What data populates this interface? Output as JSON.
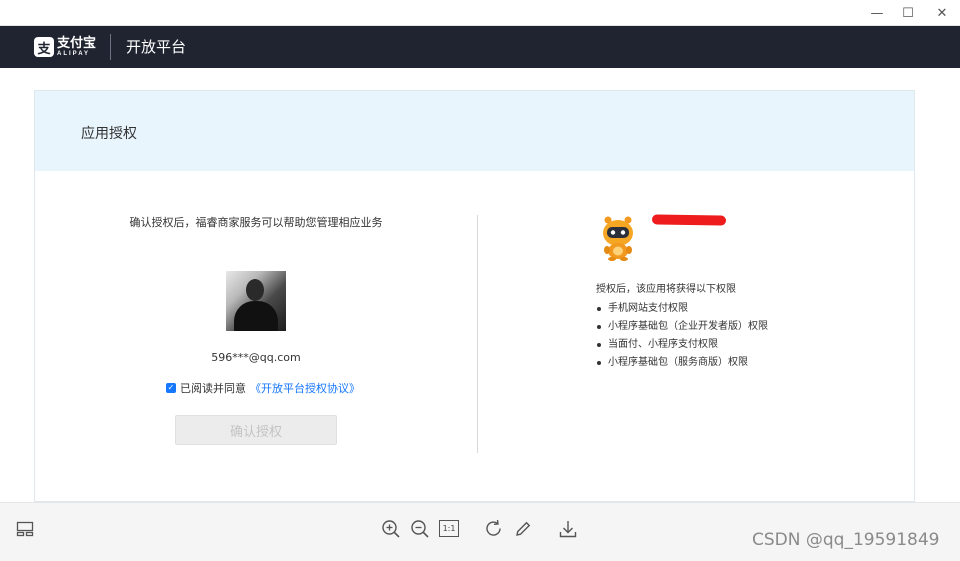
{
  "window": {
    "minimize_glyph": "—",
    "maximize_glyph": "☐",
    "close_glyph": "✕"
  },
  "app": {
    "logo_mark": "支",
    "logo_cn": "支付宝",
    "logo_en": "ALIPAY",
    "title": "开放平台"
  },
  "card": {
    "title": "应用授权"
  },
  "left": {
    "description": "确认授权后，福睿商家服务可以帮助您管理相应业务",
    "email": "596***@qq.com",
    "agree_text": "已阅读并同意",
    "agreement_link": "《开放平台授权协议》",
    "agree_checked": true,
    "confirm_label": "确认授权"
  },
  "right": {
    "mascot_icon": "robot-mascot-icon",
    "app_name_redacted": true,
    "intro": "授权后，该应用将获得以下权限",
    "permissions": [
      "手机网站支付权限",
      "小程序基础包（企业开发者版）权限",
      "当面付、小程序支付权限",
      "小程序基础包（服务商版）权限"
    ]
  },
  "toolbar": {
    "icons": [
      "thumbnail-panel-icon",
      "zoom-in-icon",
      "zoom-out-icon",
      "actual-size-icon",
      "rotate-icon",
      "edit-icon",
      "download-icon"
    ],
    "actual_size_label": "1:1",
    "watermark": "CSDN @qq_19591849"
  },
  "colors": {
    "header_bg": "#1f2430",
    "card_head_bg": "#e9f5fd",
    "link": "#1677ff",
    "redaction": "#ee1c1c"
  }
}
